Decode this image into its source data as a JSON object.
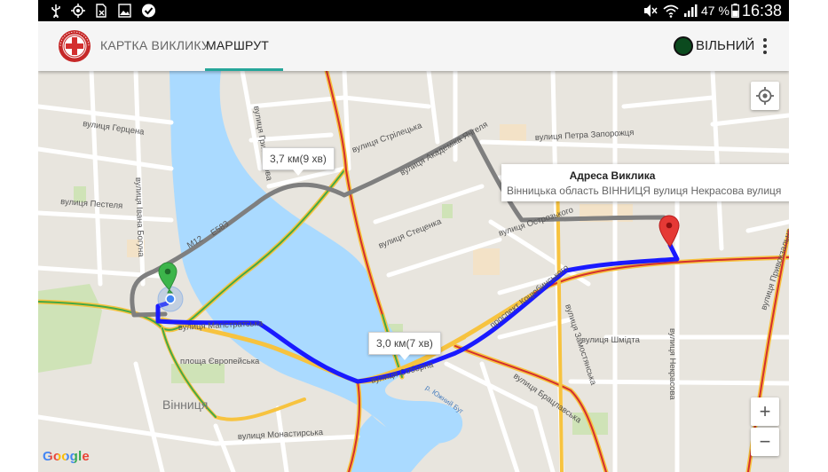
{
  "status_bar": {
    "battery_percent": "47 %",
    "time": "16:38",
    "icons": [
      "usb-icon",
      "gps-icon",
      "sim-missing-icon",
      "gallery-icon",
      "check-icon",
      "mute-icon",
      "wifi-icon",
      "signal-icon",
      "battery-icon"
    ]
  },
  "toolbar": {
    "logo": "red-cross-logo-icon",
    "tabs": [
      {
        "label": "КАРТКА ВИКЛИКУ",
        "selected": false
      },
      {
        "label": "МАРШРУТ",
        "selected": true
      }
    ],
    "status_label": "ВІЛЬНИЙ",
    "status_color": "#0b4a1e",
    "accent_color": "#26a69a",
    "menu_icon": "more-vert-icon"
  },
  "map": {
    "route_bubbles": [
      {
        "text": "3,7 км(9 хв)"
      },
      {
        "text": "3,0 км(7 хв)"
      }
    ],
    "info_window": {
      "title": "Адреса Виклика",
      "address": "Вінницька область ВІННИЦЯ вулиця Некрасова вулиця"
    },
    "street_labels": [
      "вулиця Герцена",
      "вулиця Пестеля",
      "вулиця Івана Богуна",
      "вулиця Грибоєдова",
      "вулиця Стрілецька",
      "вулиця Академіка Янгеля",
      "вулиця Петра Запорожця",
      "вулиця Стеценка",
      "вулиця Острозького",
      "проспект Коцюбинського",
      "вулиця Замостянська",
      "вулиця Шмідта",
      "вулиця Некрасова",
      "вулиця Привокзальна",
      "вулиця Магістратська",
      "вулиця Соборна",
      "площа Європейська",
      "Вінниця",
      "вулиця Монастирська",
      "вулиця Брацлавська",
      "р. Южний Буг",
      "M12",
      "E583"
    ],
    "route_color": "#1a1aff",
    "alt_route_color": "#7f7f7f",
    "origin_marker_color": "#3cb54a",
    "destination_marker_color": "#e53935",
    "controls": {
      "my_location_icon": "my-location-icon",
      "zoom_in": "+",
      "zoom_out": "−"
    },
    "attribution": "Google"
  }
}
